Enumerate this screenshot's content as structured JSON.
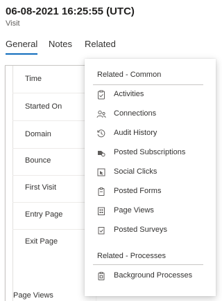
{
  "record": {
    "title": "06-08-2021 16:25:55 (UTC)",
    "entity_type": "Visit"
  },
  "tabs": [
    {
      "label": "General",
      "selected": true
    },
    {
      "label": "Notes",
      "selected": false
    },
    {
      "label": "Related",
      "selected": false
    }
  ],
  "form": {
    "fields": [
      {
        "label": "Time"
      },
      {
        "label": "Started On"
      },
      {
        "label": "Domain"
      },
      {
        "label": "Bounce"
      },
      {
        "label": "First Visit"
      },
      {
        "label": "Entry Page"
      },
      {
        "label": "Exit Page"
      }
    ],
    "next_section_label": "Page Views"
  },
  "related_menu": {
    "common_heading": "Related - Common",
    "common_items": [
      {
        "label": "Activities",
        "icon": "clipboard-check-icon"
      },
      {
        "label": "Connections",
        "icon": "people-connections-icon"
      },
      {
        "label": "Audit History",
        "icon": "history-clock-icon"
      },
      {
        "label": "Posted Subscriptions",
        "icon": "subscription-tag-icon"
      },
      {
        "label": "Social Clicks",
        "icon": "cursor-click-icon"
      },
      {
        "label": "Posted Forms",
        "icon": "form-document-icon"
      },
      {
        "label": "Page Views",
        "icon": "page-grid-icon"
      },
      {
        "label": "Posted Surveys",
        "icon": "survey-check-icon"
      }
    ],
    "processes_heading": "Related - Processes",
    "process_items": [
      {
        "label": "Background Processes",
        "icon": "process-clipboard-icon"
      }
    ]
  },
  "colors": {
    "accent": "#0f6cbd",
    "text": "#323130",
    "divider": "#c8c6c4"
  }
}
